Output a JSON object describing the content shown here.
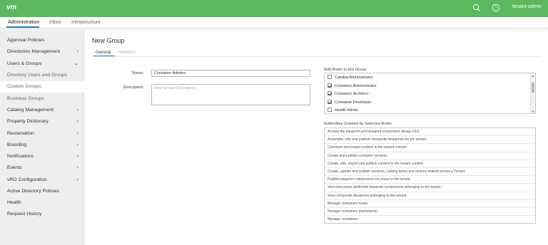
{
  "app": {
    "logo": "vm",
    "user": "tenant-admin"
  },
  "tabs": [
    {
      "label": "Administration",
      "active": true
    },
    {
      "label": "Inbox",
      "active": false
    },
    {
      "label": "Infrastructure",
      "active": false
    }
  ],
  "sidebar": {
    "items": [
      {
        "label": "Approval Policies",
        "chevron": ""
      },
      {
        "label": "Directories Management",
        "chevron": "›"
      },
      {
        "label": "Users & Groups",
        "chevron": "⌄"
      },
      {
        "label": "Directory Users and Groups",
        "chevron": ""
      },
      {
        "label": "Custom Groups",
        "chevron": ""
      },
      {
        "label": "Business Groups",
        "chevron": ""
      },
      {
        "label": "Catalog Management",
        "chevron": "›"
      },
      {
        "label": "Property Dictionary",
        "chevron": "›"
      },
      {
        "label": "Reclamation",
        "chevron": "›"
      },
      {
        "label": "Branding",
        "chevron": "›"
      },
      {
        "label": "Notifications",
        "chevron": "›"
      },
      {
        "label": "Events",
        "chevron": "›"
      },
      {
        "label": "vRO Configuration",
        "chevron": "›"
      },
      {
        "label": "Active Directory Policies",
        "chevron": ""
      },
      {
        "label": "Health",
        "chevron": ""
      },
      {
        "label": "Request History",
        "chevron": ""
      }
    ]
  },
  "main": {
    "title": "New Group",
    "subtabs": [
      {
        "label": "General",
        "active": true
      },
      {
        "label": "Members",
        "active": false
      }
    ],
    "form": {
      "name_label": "Name:",
      "name_required": "*",
      "name_value": "Container Admins",
      "description_label": "Description:",
      "description_placeholder": "New Group Description"
    },
    "roles": {
      "label": "Add Roles to this Group",
      "items": [
        {
          "label": "Catalog Administrator",
          "checked": false
        },
        {
          "label": "Container Administrator",
          "checked": true
        },
        {
          "label": "Container Architect",
          "checked": true
        },
        {
          "label": "Container Developer",
          "checked": true
        },
        {
          "label": "Health Admin",
          "checked": false
        }
      ]
    },
    "authorities": {
      "label": "Authorities Granted by Selected Roles",
      "items": [
        "Access the blueprint and blueprint component design GUI.",
        "Assemble, edit and publish composite blueprints for the tenant.",
        "Consume and export content in the tenant context.",
        "Create and publish container services.",
        "Create, edit, import and publish content in the tenant context.",
        "Create, update and publish services, catalog items and actions shared across a Tenant.",
        "Publish blueprint components for reuse in the tenant.",
        "View and reuse published blueprint components belonging to the tenant.",
        "View composite blueprints belonging to the tenant.",
        "Manage containers hosts.",
        "Manage containers placements.",
        "Manage containers."
      ]
    }
  },
  "colors": {
    "header": "#5bb85e",
    "accent": "#2a7fc1",
    "sidebar_bg": "#eeeeee"
  },
  "icons": {
    "search": "search-icon",
    "help": "help-icon"
  }
}
